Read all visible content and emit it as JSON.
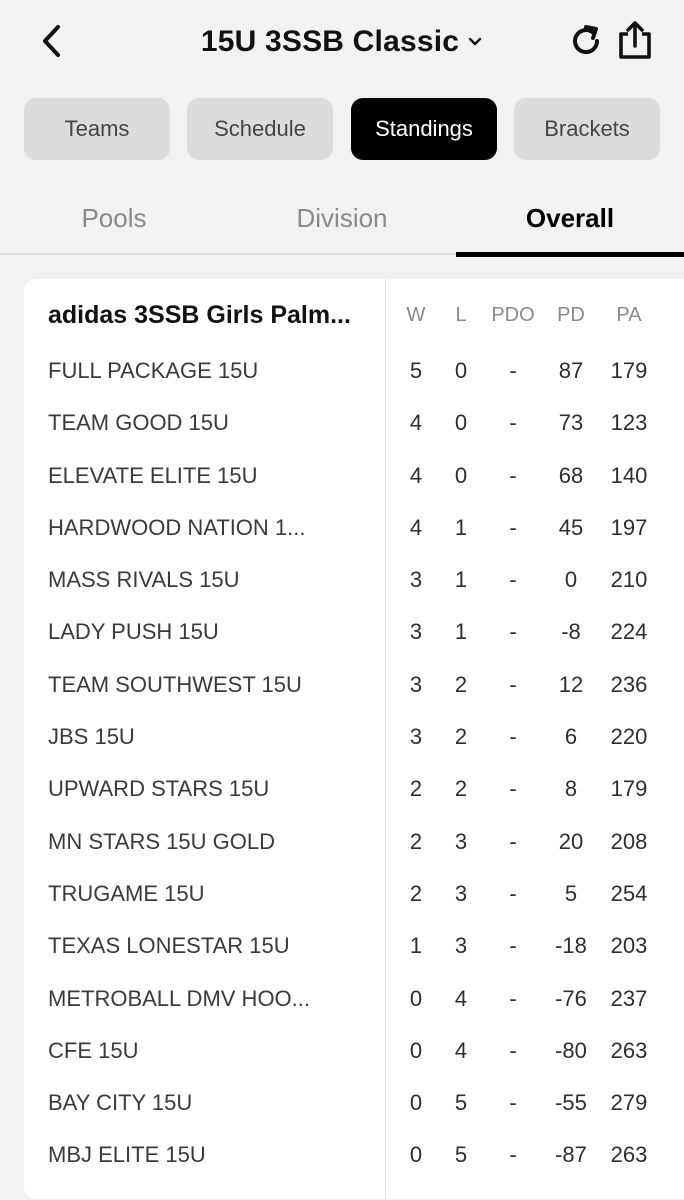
{
  "header": {
    "title": "15U 3SSB Classic",
    "back_icon": "chevron-left-icon",
    "dropdown_icon": "chevron-down-icon",
    "refresh_icon": "refresh-icon",
    "share_icon": "share-icon"
  },
  "tabs": [
    {
      "label": "Teams",
      "active": false
    },
    {
      "label": "Schedule",
      "active": false
    },
    {
      "label": "Standings",
      "active": true
    },
    {
      "label": "Brackets",
      "active": false
    }
  ],
  "subtabs": [
    {
      "label": "Pools",
      "active": false
    },
    {
      "label": "Division",
      "active": false
    },
    {
      "label": "Overall",
      "active": true
    }
  ],
  "standings": {
    "pool_title": "adidas 3SSB Girls Palm...",
    "columns": [
      "W",
      "L",
      "PDO",
      "PD",
      "PA"
    ],
    "rows": [
      {
        "team": "FULL PACKAGE 15U",
        "w": "5",
        "l": "0",
        "pdo": "-",
        "pd": "87",
        "pa": "179"
      },
      {
        "team": "TEAM GOOD 15U",
        "w": "4",
        "l": "0",
        "pdo": "-",
        "pd": "73",
        "pa": "123"
      },
      {
        "team": "ELEVATE ELITE 15U",
        "w": "4",
        "l": "0",
        "pdo": "-",
        "pd": "68",
        "pa": "140"
      },
      {
        "team": "HARDWOOD NATION 1...",
        "w": "4",
        "l": "1",
        "pdo": "-",
        "pd": "45",
        "pa": "197"
      },
      {
        "team": "MASS RIVALS 15U",
        "w": "3",
        "l": "1",
        "pdo": "-",
        "pd": "0",
        "pa": "210"
      },
      {
        "team": "LADY PUSH 15U",
        "w": "3",
        "l": "1",
        "pdo": "-",
        "pd": "-8",
        "pa": "224"
      },
      {
        "team": "TEAM SOUTHWEST 15U",
        "w": "3",
        "l": "2",
        "pdo": "-",
        "pd": "12",
        "pa": "236"
      },
      {
        "team": "JBS 15U",
        "w": "3",
        "l": "2",
        "pdo": "-",
        "pd": "6",
        "pa": "220"
      },
      {
        "team": "UPWARD STARS 15U",
        "w": "2",
        "l": "2",
        "pdo": "-",
        "pd": "8",
        "pa": "179"
      },
      {
        "team": "MN STARS 15U GOLD",
        "w": "2",
        "l": "3",
        "pdo": "-",
        "pd": "20",
        "pa": "208"
      },
      {
        "team": "TRUGAME 15U",
        "w": "2",
        "l": "3",
        "pdo": "-",
        "pd": "5",
        "pa": "254"
      },
      {
        "team": "TEXAS LONESTAR 15U",
        "w": "1",
        "l": "3",
        "pdo": "-",
        "pd": "-18",
        "pa": "203"
      },
      {
        "team": "METROBALL DMV HOO...",
        "w": "0",
        "l": "4",
        "pdo": "-",
        "pd": "-76",
        "pa": "237"
      },
      {
        "team": "CFE 15U",
        "w": "0",
        "l": "4",
        "pdo": "-",
        "pd": "-80",
        "pa": "263"
      },
      {
        "team": "BAY CITY 15U",
        "w": "0",
        "l": "5",
        "pdo": "-",
        "pd": "-55",
        "pa": "279"
      },
      {
        "team": "MBJ ELITE 15U",
        "w": "0",
        "l": "5",
        "pdo": "-",
        "pd": "-87",
        "pa": "263"
      }
    ]
  }
}
